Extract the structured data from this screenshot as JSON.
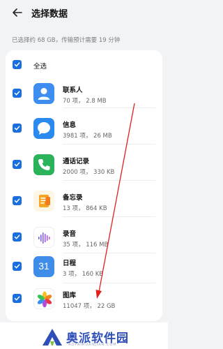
{
  "header": {
    "title": "选择数据",
    "back_icon": "back-arrow-icon"
  },
  "summary": "已选择约 68 GB，传输预计需要 19 分钟",
  "select_all": {
    "label": "全选",
    "checked": true
  },
  "items": [
    {
      "name": "联系人",
      "meta": "70 项，  2.8 MB",
      "icon": "contacts-icon",
      "color": "#3d8ef0",
      "checked": true
    },
    {
      "name": "信息",
      "meta": "3981 项，  26 MB",
      "icon": "messages-icon",
      "color": "#2a8af0",
      "checked": true
    },
    {
      "name": "通话记录",
      "meta": "2000 项，  330 KB",
      "icon": "phone-icon",
      "color": "#2ab35a",
      "checked": true
    },
    {
      "name": "备忘录",
      "meta": "13 项，  864 KB",
      "icon": "notes-icon",
      "color": "#f5a623",
      "checked": true
    },
    {
      "name": "录音",
      "meta": "35 项，  116 MB",
      "icon": "recorder-icon",
      "color": "#ffffff",
      "checked": true
    },
    {
      "name": "日程",
      "meta": "3 项，  160 KB",
      "icon": "calendar-icon",
      "color": "#3f8de8",
      "checked": true
    },
    {
      "name": "图库",
      "meta": "11047 项，  22 GB",
      "icon": "gallery-icon",
      "color": "#ffffff",
      "checked": true
    }
  ],
  "calendar_day": "31",
  "annotation": {
    "type": "red-arrow",
    "color": "#e02020"
  },
  "watermark": {
    "text": "奥派软件园",
    "url": "AOPAIRUANJIAN.COM",
    "color": "#2f4fb8"
  }
}
